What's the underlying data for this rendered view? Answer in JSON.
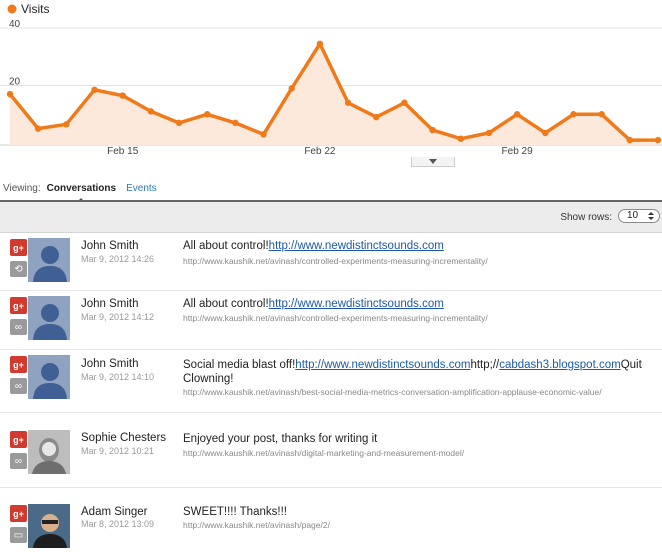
{
  "chart": {
    "legend": "Visits",
    "color": "#f07a1a",
    "chart_data": {
      "type": "area",
      "series": [
        {
          "name": "Visits",
          "values": [
            17,
            5,
            6.5,
            18.5,
            16.5,
            11,
            7,
            10,
            7,
            3,
            19,
            34.5,
            14,
            9,
            14,
            4.5,
            1.5,
            3.5,
            10,
            3.5,
            10,
            10,
            1,
            1
          ]
        }
      ],
      "x_tick_labels": [
        "Feb 15",
        "Feb 22",
        "Feb 29"
      ],
      "x_tick_index": [
        4,
        11,
        18
      ],
      "y_tick_labels": [
        "40",
        "20"
      ],
      "ylim": [
        0,
        40
      ]
    }
  },
  "viewing": {
    "label": "Viewing:",
    "active_tab": "Conversations",
    "other_tab": "Events"
  },
  "toolbar": {
    "show_rows_label": "Show rows:",
    "rows_value": "10"
  },
  "rows": [
    {
      "name": "John Smith",
      "time": "Mar 9, 2012 14:26",
      "text_before": "All about control!",
      "link": "http://www.newdistinctsounds.com",
      "text_after": "",
      "url": "http://www.kaushik.net/avinash/controlled-experiments-measuring-incrementality/",
      "type_icon": "reshare-icon"
    },
    {
      "name": "John Smith",
      "time": "Mar 9, 2012 14:12",
      "text_before": "All about control!",
      "link": "http://www.newdistinctsounds.com",
      "text_after": "",
      "url": "http://www.kaushik.net/avinash/controlled-experiments-measuring-incrementality/",
      "type_icon": "link-icon"
    },
    {
      "name": "John Smith",
      "time": "Mar 9, 2012 14:10",
      "text_before": "Social media blast off!",
      "link": "http://www.newdistinctsounds.com",
      "mid": "http;//",
      "link2": "cabdash3.blogspot.com",
      "text_after": "Quit Clowning!",
      "url": "http://www.kaushik.net/avinash/best-social-media-metrics-conversation-amplification-applause-economic-value/",
      "type_icon": "link-icon"
    },
    {
      "name": "Sophie Chesters",
      "time": "Mar 9, 2012 10:21",
      "text_before": "Enjoyed your post, thanks for writing it",
      "url": "http://www.kaushik.net/avinash/digital-marketing-and-measurement-model/",
      "type_icon": "link-icon"
    },
    {
      "name": "Adam Singer",
      "time": "Mar 8, 2012 13:09",
      "text_before": "SWEET!!!! Thanks!!!",
      "url": "http://www.kaushik.net/avinash/page/2/",
      "type_icon": "comment-icon"
    }
  ],
  "gplus_label": "g+"
}
